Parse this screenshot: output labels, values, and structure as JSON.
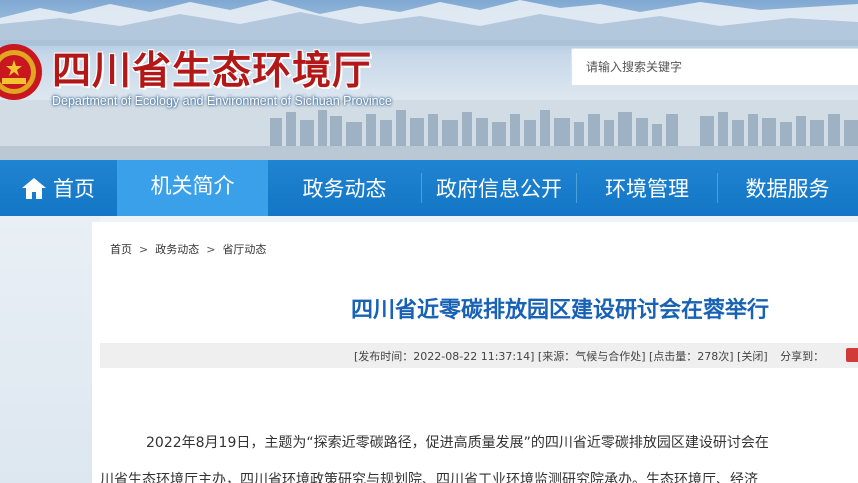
{
  "header": {
    "title": "四川省生态环境厅",
    "subtitle": "Department of Ecology and Environment of Sichuan Province",
    "search_placeholder": "请输入搜索关键字"
  },
  "nav": {
    "items": [
      {
        "label": "首页",
        "icon": "home-icon"
      },
      {
        "label": "机关简介"
      },
      {
        "label": "政务动态"
      },
      {
        "label": "政府信息公开"
      },
      {
        "label": "环境管理"
      },
      {
        "label": "数据服务"
      }
    ],
    "active_index": 1
  },
  "breadcrumb": {
    "items": [
      "首页",
      "政务动态",
      "省厅动态"
    ],
    "separator": ">"
  },
  "article": {
    "title": "四川省近零碳排放园区建设研讨会在蓉举行",
    "meta": "[发布时间：2022-08-22 11:37:14] [来源：气候与合作处] [点击量：278次] [关闭]",
    "share_label": "分享到：",
    "paragraph1": "2022年8月19日，主题为“探索近零碳路径，促进高质量发展”的四川省近零碳排放园区建设研讨会在",
    "paragraph2": "川省生态环境厅主办，四川省环境政策研究与规划院、四川省工业环境监测研究院承办。生态环境厅、经济"
  },
  "colors": {
    "nav_bg": "#1476c6",
    "nav_active": "#3aa0ea",
    "title_red": "#b31818",
    "article_title": "#1862b5"
  }
}
